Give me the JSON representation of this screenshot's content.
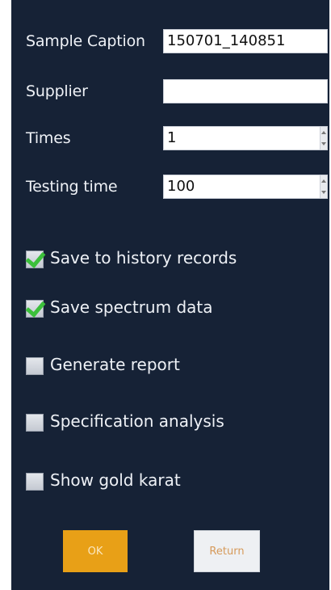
{
  "form": {
    "sample_caption": {
      "label": "Sample Caption",
      "value": "150701_140851"
    },
    "supplier": {
      "label": "Supplier",
      "value": ""
    },
    "times": {
      "label": "Times",
      "value": "1"
    },
    "testing_time": {
      "label": "Testing time",
      "value": "100"
    }
  },
  "options": [
    {
      "label": "Save to history records",
      "checked": true
    },
    {
      "label": "Save spectrum data",
      "checked": true
    },
    {
      "label": "Generate report",
      "checked": false
    },
    {
      "label": "Specification analysis",
      "checked": false
    },
    {
      "label": "Show gold karat",
      "checked": false
    }
  ],
  "buttons": {
    "ok_label": "OK",
    "return_label": "Return"
  },
  "colors": {
    "panel_bg": "#162236",
    "ok_button": "#e8a017",
    "check_green": "#3bbf3b"
  }
}
